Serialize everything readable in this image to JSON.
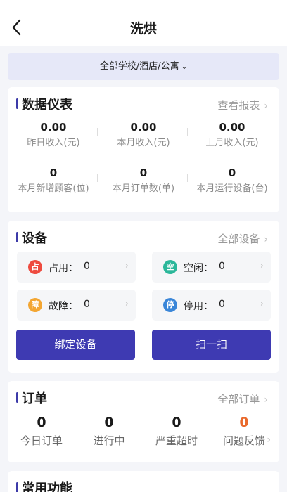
{
  "header": {
    "title": "洗烘"
  },
  "filter": {
    "label": "全部学校/酒店/公寓"
  },
  "dashboard": {
    "title": "数据仪表",
    "more_label": "查看报表",
    "stats": [
      {
        "value": "0.00",
        "label": "昨日收入(元)"
      },
      {
        "value": "0.00",
        "label": "本月收入(元)"
      },
      {
        "value": "0.00",
        "label": "上月收入(元)"
      },
      {
        "value": "0",
        "label": "本月新增顾客(位)"
      },
      {
        "value": "0",
        "label": "本月订单数(单)"
      },
      {
        "value": "0",
        "label": "本月运行设备(台)"
      }
    ]
  },
  "devices": {
    "title": "设备",
    "more_label": "全部设备",
    "tiles": [
      {
        "badge": "占",
        "label": "占用：",
        "value": "0",
        "color": "#ee4b3f"
      },
      {
        "badge": "空",
        "label": "空闲：",
        "value": "0",
        "color": "#2bb79a"
      },
      {
        "badge": "障",
        "label": "故障：",
        "value": "0",
        "color": "#f3a632"
      },
      {
        "badge": "停",
        "label": "停用：",
        "value": "0",
        "color": "#3a86d8"
      }
    ],
    "bind_button": "绑定设备",
    "scan_button": "扫一扫"
  },
  "orders": {
    "title": "订单",
    "more_label": "全部订单",
    "stats": [
      {
        "value": "0",
        "label": "今日订单"
      },
      {
        "value": "0",
        "label": "进行中"
      },
      {
        "value": "0",
        "label": "严重超时"
      },
      {
        "value": "0",
        "label": "问题反馈"
      }
    ]
  },
  "functions": {
    "title": "常用功能"
  },
  "colors": {
    "accent": "#3e3ab2",
    "warning": "#e9692c"
  }
}
